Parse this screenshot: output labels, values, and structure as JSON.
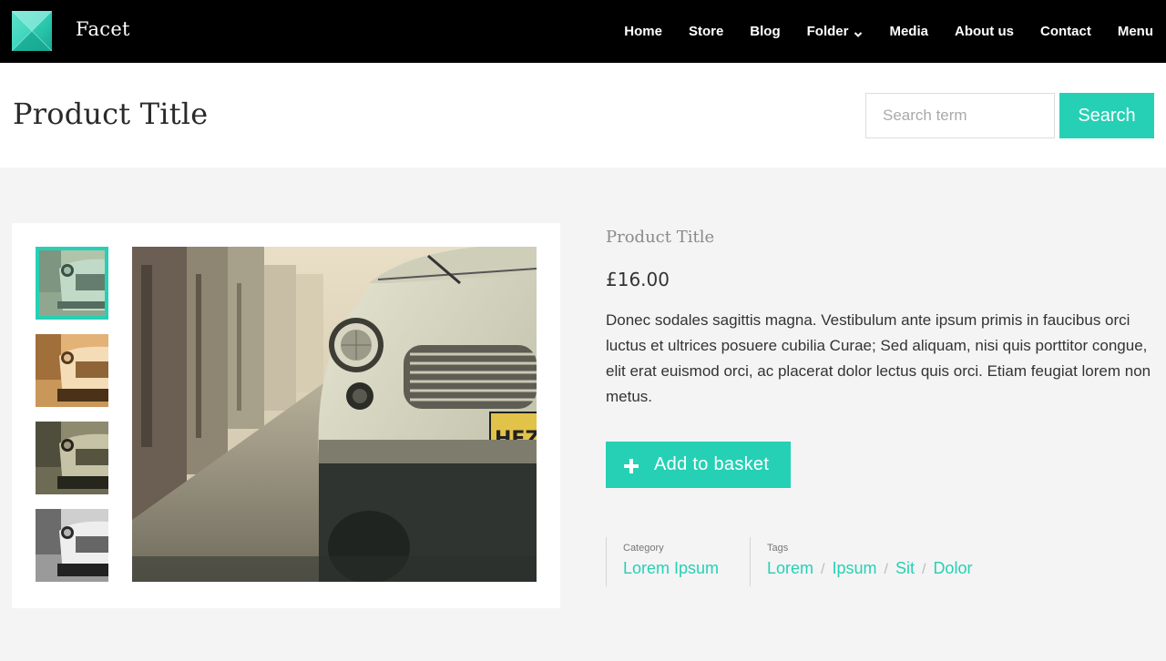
{
  "header": {
    "brand": "Facet",
    "logo_icon": "facet-logo",
    "nav": [
      {
        "label": "Home"
      },
      {
        "label": "Store"
      },
      {
        "label": "Blog"
      },
      {
        "label": "Folder",
        "icon": "chevron-down-icon"
      },
      {
        "label": "Media"
      },
      {
        "label": "About us"
      },
      {
        "label": "Contact"
      },
      {
        "label": "Menu"
      }
    ]
  },
  "page": {
    "title": "Product Title"
  },
  "search": {
    "placeholder": "Search term",
    "button_label": "Search"
  },
  "product": {
    "title": "Product Title",
    "price": "£16.00",
    "description": "Donec sodales sagittis magna. Vestibulum ante ipsum primis in faucibus orci luctus et ultrices posuere cubilia Curae; Sed aliquam, nisi quis porttitor congue, elit erat euismod orci, ac placerat dolor lectus quis orci. Etiam feugiat lorem non metus.",
    "add_button_label": "Add to basket",
    "add_button_icon": "plus-icon",
    "category_label": "Category",
    "category": "Lorem Ipsum",
    "tags_label": "Tags",
    "tags": [
      "Lorem",
      "Ipsum",
      "Sit",
      "Dolor"
    ],
    "tag_separator": "/",
    "image_plate_text": "HEZ"
  },
  "colors": {
    "accent": "#26d0b5",
    "topbar": "#000000",
    "background": "#f4f4f4"
  }
}
